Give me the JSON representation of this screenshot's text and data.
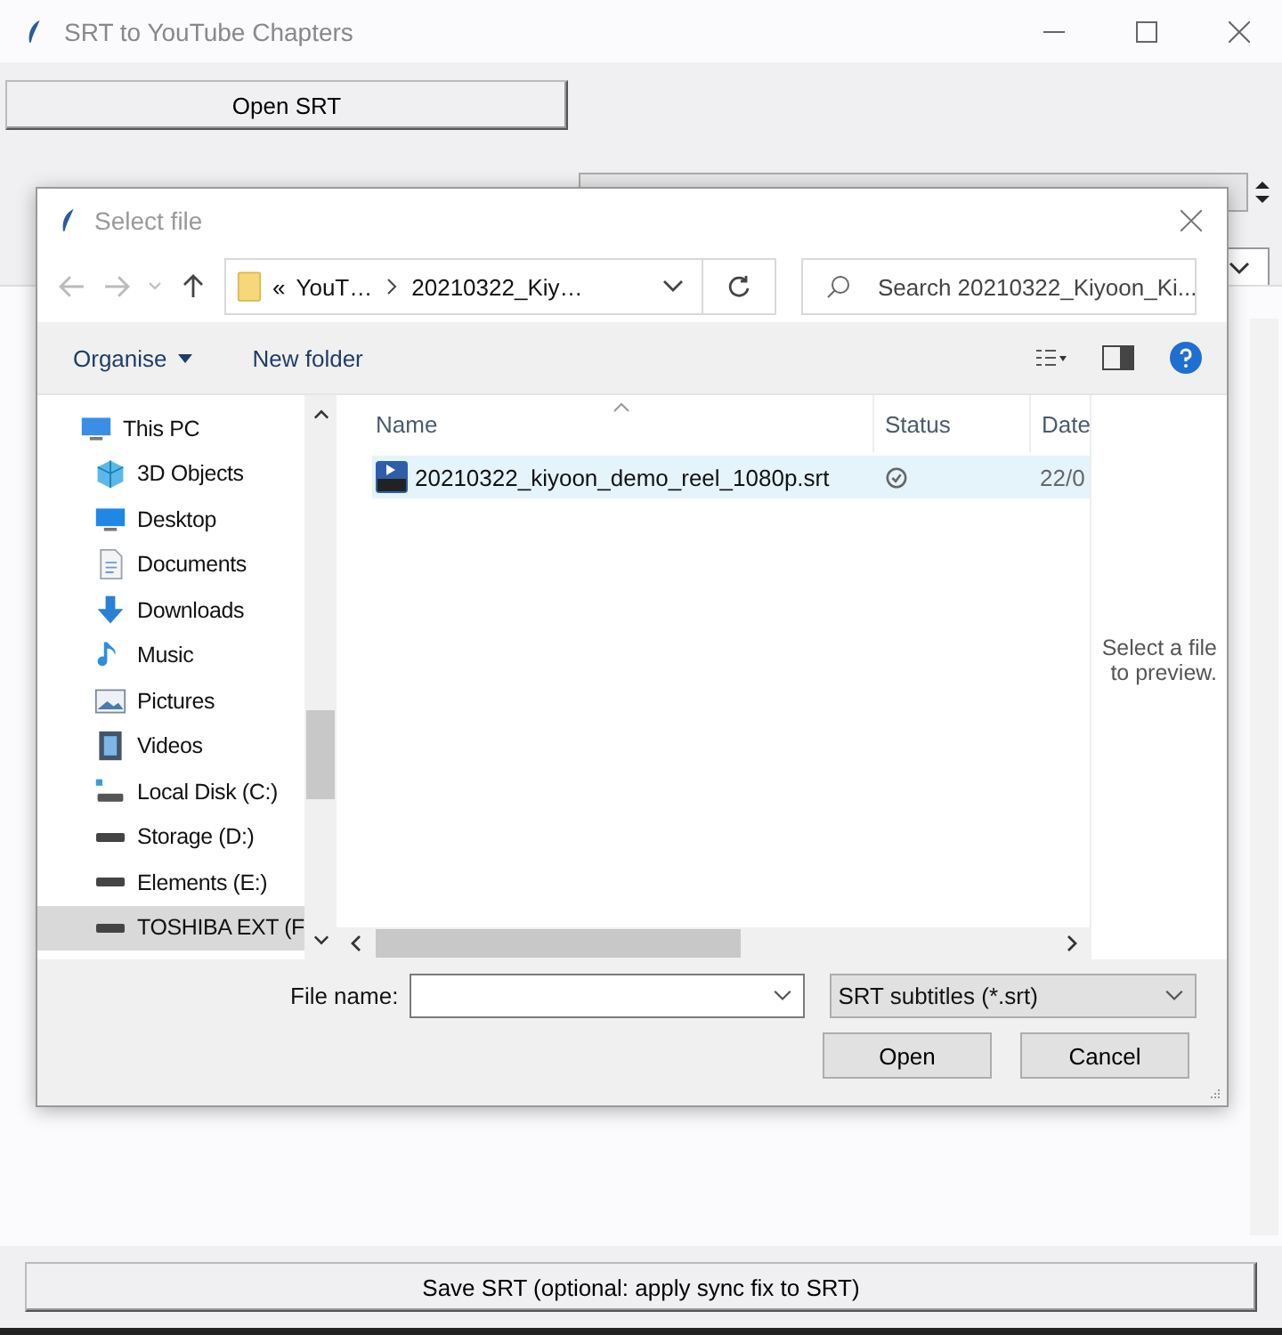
{
  "window": {
    "title": "SRT to YouTube Chapters"
  },
  "open_button": "Open SRT",
  "dialog": {
    "title": "Select file",
    "breadcrumb": [
      "«",
      "YouT…",
      "20210322_Kiy…"
    ],
    "search": {
      "placeholder": "Search 20210322_Kiyoon_Ki..."
    },
    "toolbar": {
      "organise": "Organise",
      "new_folder": "New folder"
    },
    "nav": [
      {
        "label": "This PC",
        "kind": "pc",
        "selected": false,
        "children": [
          {
            "label": "3D Objects",
            "kind": "cube",
            "selected": false
          },
          {
            "label": "Desktop",
            "kind": "desktop",
            "selected": false
          },
          {
            "label": "Documents",
            "kind": "doc",
            "selected": false
          },
          {
            "label": "Downloads",
            "kind": "download",
            "selected": false
          },
          {
            "label": "Music",
            "kind": "music",
            "selected": false
          },
          {
            "label": "Pictures",
            "kind": "pictures",
            "selected": false
          },
          {
            "label": "Videos",
            "kind": "videos",
            "selected": false
          },
          {
            "label": "Local Disk (C:)",
            "kind": "system_drive",
            "selected": false
          },
          {
            "label": "Storage (D:)",
            "kind": "drive",
            "selected": false
          },
          {
            "label": "Elements (E:)",
            "kind": "drive",
            "selected": false
          },
          {
            "label": "TOSHIBA EXT (F",
            "kind": "drive",
            "selected": true
          }
        ]
      }
    ],
    "columns": [
      "Name",
      "Status",
      "Date"
    ],
    "files": [
      {
        "name": "20210322_kiyoon_demo_reel_1080p.srt",
        "synced": true,
        "date": "22/0",
        "selected": true
      }
    ],
    "preview": "Select a file to preview.",
    "file_name_label": "File name:",
    "filter": "SRT subtitles (*.srt)",
    "buttons": [
      "Open",
      "Cancel"
    ]
  },
  "save_button": "Save SRT (optional: apply sync fix to SRT)"
}
